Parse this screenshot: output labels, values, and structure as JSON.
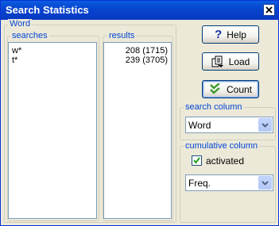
{
  "window": {
    "title": "Search Statistics"
  },
  "word_group": {
    "label": "Word"
  },
  "searches": {
    "label": "searches",
    "items": [
      "w*",
      "t*"
    ]
  },
  "results": {
    "label": "results",
    "items": [
      "208 (1715)",
      "239 (3705)"
    ]
  },
  "buttons": {
    "help": "Help",
    "load": "Load",
    "count": "Count"
  },
  "search_column": {
    "label": "search column",
    "selected": "Word"
  },
  "cumulative_column": {
    "label": "cumulative column",
    "checkbox_label": "activated",
    "checked": true,
    "selected": "Freq."
  },
  "colors": {
    "title_bar": "#0846d0",
    "group_label": "#0046d5",
    "count_icon": "#3a9a2a",
    "help_icon": "#1a2fa0"
  }
}
